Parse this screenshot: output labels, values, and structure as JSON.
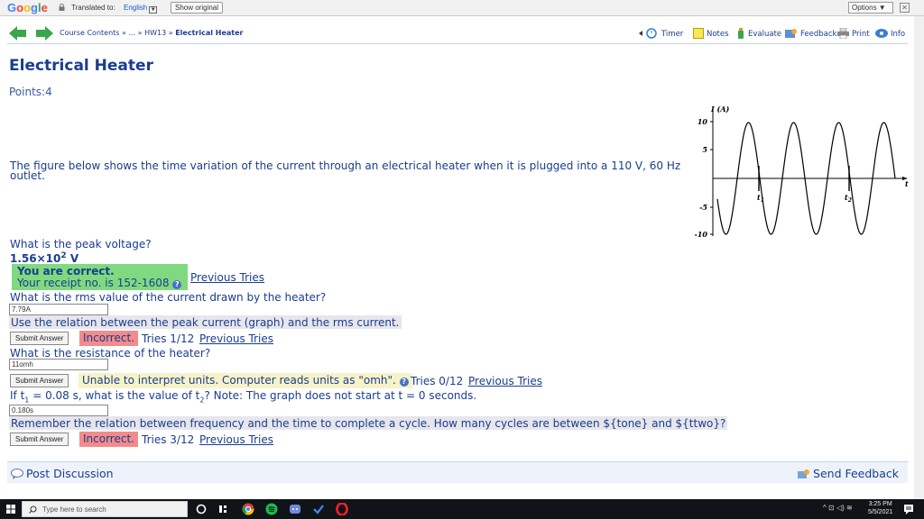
{
  "translate_bar": {
    "logo": "Google",
    "translated_to": "Translated to:",
    "language": "English",
    "show_original": "Show original",
    "options": "Options ▼",
    "logo_colors": [
      "#4285f4",
      "#ea4335",
      "#fbbc05",
      "#4285f4",
      "#34a853",
      "#ea4335"
    ]
  },
  "nav": {
    "breadcrumb_course": "Course Contents",
    "breadcrumb_sep1": "»",
    "breadcrumb_ellipsis": "...",
    "breadcrumb_sep2": "»",
    "breadcrumb_hw": "HW13",
    "breadcrumb_sep3": "»",
    "breadcrumb_current": "Electrical Heater",
    "timer": "Timer",
    "notes": "Notes",
    "evaluate": "Evaluate",
    "feedback": "Feedback",
    "print": "Print",
    "info": "Info"
  },
  "problem": {
    "title": "Electrical Heater",
    "points": "Points:4",
    "description": "The figure below shows the time variation of the current through an electrical heater when it is plugged into a 110 V, 60 Hz outlet."
  },
  "graph": {
    "y_label": "I (A)",
    "x_label": "t",
    "y_ticks": [
      "10",
      "5",
      "-5",
      "-10"
    ],
    "t1_label": "t",
    "t1_sub": "1",
    "t2_label": "t",
    "t2_sub": "2"
  },
  "q1": {
    "question": "What is the peak voltage?",
    "answer_base": "1.56×10",
    "answer_exp": "2",
    "answer_unit": " V",
    "correct_text": "You are correct.",
    "receipt": "Your receipt no. is 152-1608",
    "previous_tries": "Previous Tries"
  },
  "q2": {
    "question": "What is the rms value of the current drawn by the heater?",
    "input_value": "7.79A",
    "hint": "Use the relation between the peak current (graph) and the rms current.",
    "submit": "Submit Answer",
    "status": "Incorrect.",
    "tries": "Tries 1/12",
    "previous_tries": "Previous Tries"
  },
  "q3": {
    "question": "What is the resistance of the heater?",
    "input_value": "11omh",
    "submit": "Submit Answer",
    "status": "Unable to interpret units. Computer reads units as \"omh\".",
    "tries": "Tries 0/12",
    "previous_tries": "Previous Tries"
  },
  "q4": {
    "question_pre": "If t",
    "sub1": "1",
    "question_mid": " = 0.08 s, what is the value of t",
    "sub2": "2",
    "question_post": "? Note: The graph does not start at t = 0 seconds.",
    "input_value": "0.180s",
    "hint": "Remember the relation between frequency and the time to complete a cycle. How many cycles are between ${tone} and ${ttwo}?",
    "submit": "Submit Answer",
    "status": "Incorrect.",
    "tries": "Tries 3/12",
    "previous_tries": "Previous Tries"
  },
  "footer": {
    "post_discussion": "Post Discussion",
    "send_feedback": "Send Feedback"
  },
  "taskbar": {
    "search_placeholder": "Type here to search",
    "time": "3:25 PM",
    "date": "5/5/2021"
  }
}
